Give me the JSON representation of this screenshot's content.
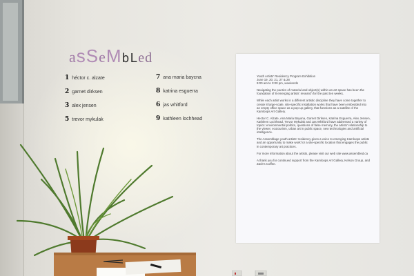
{
  "title": {
    "part1": "a",
    "part2": "sS",
    "part3": "e",
    "part4": "M",
    "part5": "bL",
    "part6": "ed"
  },
  "artists_left": [
    {
      "num": "1",
      "name": "héctor c. alzate"
    },
    {
      "num": "2",
      "name": "garnet dirksen"
    },
    {
      "num": "3",
      "name": "alex jensen"
    },
    {
      "num": "5",
      "name": "trevor mykulak"
    }
  ],
  "artists_right": [
    {
      "num": "7",
      "name": "ana maria baycna"
    },
    {
      "num": "8",
      "name": "katrina esguerra"
    },
    {
      "num": "6",
      "name": "jas whitford"
    },
    {
      "num": "9",
      "name": "kathleen lochhead"
    }
  ],
  "poster": {
    "heading": "Youth Artists' Residency Program Exhibition",
    "dates": "June 19, 20, 21, 27 & 28",
    "hours": "9:00 am to 3:00 pm, weekends",
    "p1": "Navigating the poetics of material and object(s) within an art space has been the foundation of 8 emerging artists' research for the past ten weeks.",
    "p2": "While each artist works in a different artistic discipline they have come together to create 8 large-scale, site-specific installation works that have been embedded into an empty office space as a pop-up gallery, that functions as a satellite of the Kamloops Art Gallery.",
    "p3": "Hector C. Alzate, Ana Maria Bayona, Garnet Dirksen, Katrina Esguerra, Alex Jensen, Kathleen Lochhead, Trevor Mykulak and Jas Whitford have addressed a variety of topics: environmental politics, questions of false memory, the artists' relationship to the viewer, ecotourism, urban art in public space, new technologies and artificial intelligence.",
    "p4": "The Assemblage youth artists' residency gives a voice to emerging Kamloops artists and an opportunity to make work for a site-specific location that engages the public in contemporary art practices.",
    "p5": "For more information about the artists, please visit our web site www.assembled.ca",
    "p6": "A thank you for continued support from the Kamloops Art Gallery, Kelson Group, and Zack's Coffee."
  }
}
